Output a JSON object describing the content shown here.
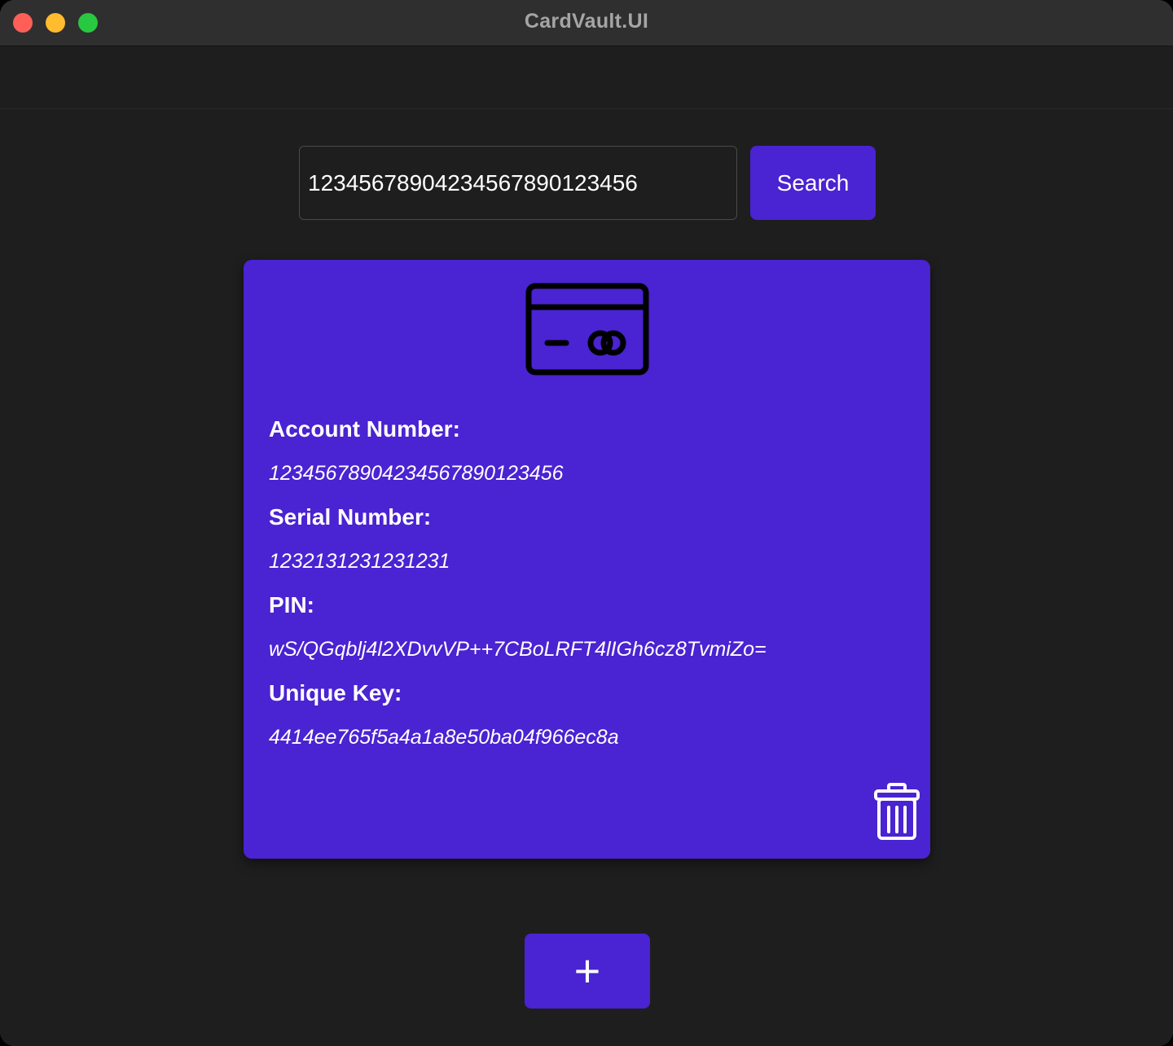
{
  "window": {
    "title": "CardVault.UI"
  },
  "search": {
    "value": "12345678904234567890123456",
    "button_label": "Search"
  },
  "card": {
    "icon": "credit-card-icon",
    "fields": [
      {
        "label": "Account Number:",
        "value": "12345678904234567890123456"
      },
      {
        "label": "Serial Number:",
        "value": "1232131231231231"
      },
      {
        "label": "PIN:",
        "value": "wS/QGqblj4l2XDvvVP++7CBoLRFT4lIGh6cz8TvmiZo="
      },
      {
        "label": "Unique Key:",
        "value": "4414ee765f5a4a1a8e50ba04f966ec8a"
      }
    ],
    "delete_icon": "trash-icon"
  },
  "actions": {
    "add_label": "+"
  },
  "colors": {
    "accent": "#4a23d2",
    "background": "#1e1e1e",
    "titlebar": "#2f2f2f",
    "text": "#ffffff"
  }
}
